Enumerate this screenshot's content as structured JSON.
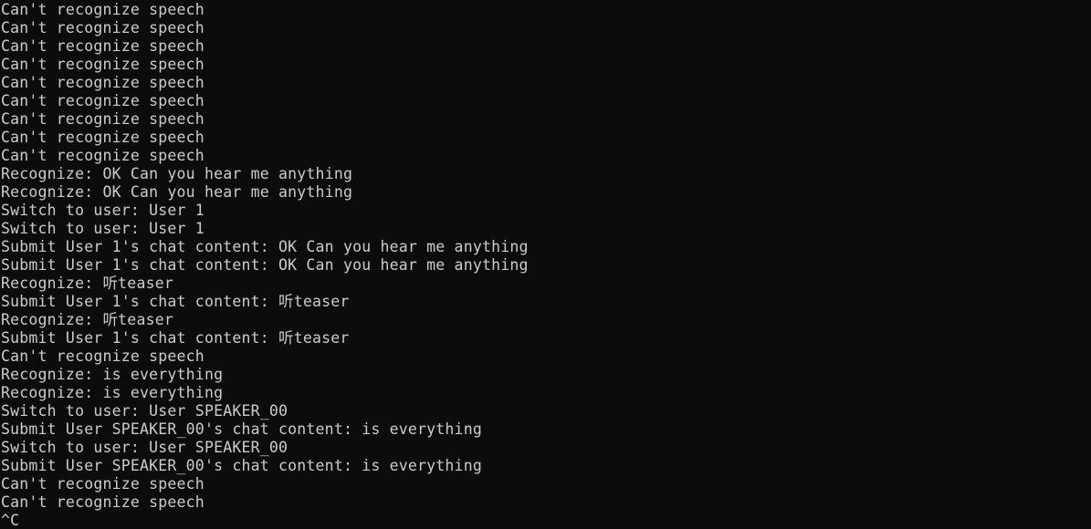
{
  "terminal": {
    "lines": [
      "Can't recognize speech",
      "Can't recognize speech",
      "Can't recognize speech",
      "Can't recognize speech",
      "Can't recognize speech",
      "Can't recognize speech",
      "Can't recognize speech",
      "Can't recognize speech",
      "Can't recognize speech",
      "Recognize: OK Can you hear me anything",
      "Recognize: OK Can you hear me anything",
      "Switch to user: User 1",
      "Switch to user: User 1",
      "Submit User 1's chat content: OK Can you hear me anything",
      "Submit User 1's chat content: OK Can you hear me anything",
      "Recognize: 听teaser",
      "Submit User 1's chat content: 听teaser",
      "Recognize: 听teaser",
      "Submit User 1's chat content: 听teaser",
      "Can't recognize speech",
      "Recognize: is everything",
      "Recognize: is everything",
      "Switch to user: User SPEAKER_00",
      "Submit User SPEAKER_00's chat content: is everything",
      "Switch to user: User SPEAKER_00",
      "Submit User SPEAKER_00's chat content: is everything",
      "Can't recognize speech",
      "Can't recognize speech",
      "^C"
    ]
  },
  "colors": {
    "background": "#0c0c0c",
    "text": "#cccccc"
  }
}
